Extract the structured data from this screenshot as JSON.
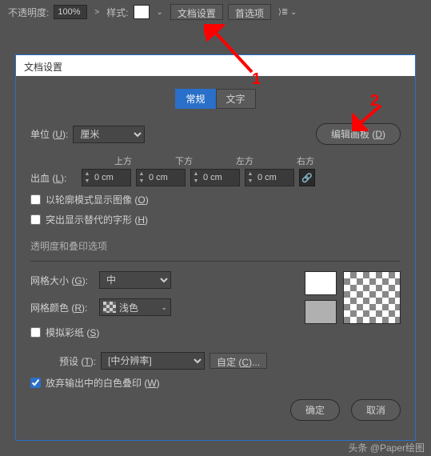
{
  "toolbar": {
    "opacity_label": "不透明度:",
    "opacity_value": "100%",
    "style_label": "样式:",
    "doc_settings": "文档设置",
    "preferences": "首选项"
  },
  "annotations": {
    "label1": "1",
    "label2": "2"
  },
  "dialog": {
    "title": "文档设置",
    "tabs": {
      "general": "常规",
      "text": "文字"
    },
    "unit_label": "单位 (U):",
    "unit_value": "厘米",
    "edit_artboard": "编辑画板 (D)",
    "bleed_label": "出血 (L):",
    "bleed_headers": {
      "top": "上方",
      "bottom": "下方",
      "left": "左方",
      "right": "右方"
    },
    "bleed": {
      "top": "0 cm",
      "bottom": "0 cm",
      "left": "0 cm",
      "right": "0 cm"
    },
    "outline_mode": "以轮廓模式显示图像 (O)",
    "highlight_sub": "突出显示替代的字形 (H)",
    "transparency_section": "透明度和叠印选项",
    "grid_size_label": "网格大小 (G):",
    "grid_size_value": "中",
    "grid_color_label": "网格颜色 (R):",
    "grid_color_value": "浅色",
    "simulate_paper": "模拟彩纸 (S)",
    "preset_label": "预设 (T):",
    "preset_value": "[中分辨率]",
    "custom_btn": "自定 (C)...",
    "discard_white": "放弃输出中的白色叠印 (W)",
    "ok": "确定",
    "cancel": "取消"
  },
  "footer": {
    "caption": "头条 @Paper绘图"
  }
}
